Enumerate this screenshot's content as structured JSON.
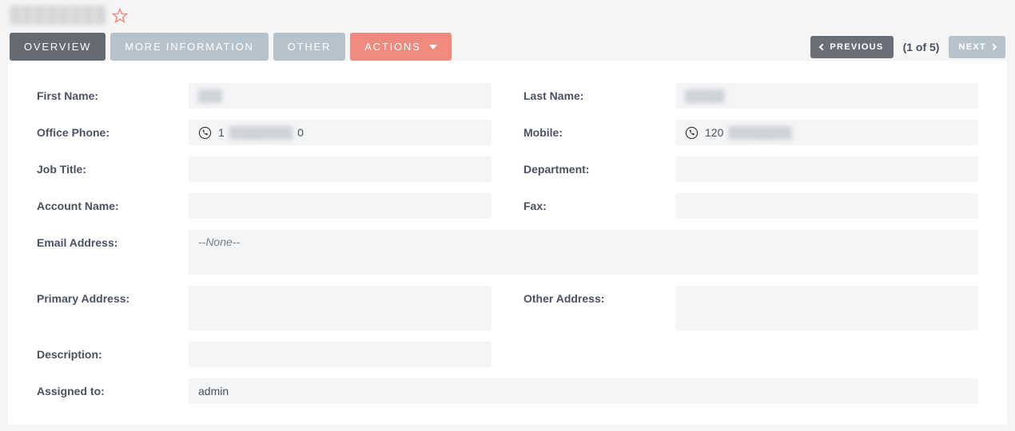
{
  "title_obscured": "████████",
  "tabs": {
    "overview": "OVERVIEW",
    "more_info": "MORE INFORMATION",
    "other": "OTHER",
    "actions": "ACTIONS"
  },
  "pager": {
    "previous": "PREVIOUS",
    "next": "NEXT",
    "position": "(1 of 5)"
  },
  "labels": {
    "first_name": "First Name:",
    "last_name": "Last Name:",
    "office_phone": "Office Phone:",
    "mobile": "Mobile:",
    "job_title": "Job Title:",
    "department": "Department:",
    "account_name": "Account Name:",
    "fax": "Fax:",
    "email": "Email Address:",
    "primary_addr": "Primary Address:",
    "other_addr": "Other Address:",
    "description": "Description:",
    "assigned_to": "Assigned to:"
  },
  "values": {
    "first_name_obscured": "███",
    "last_name_obscured": "█████",
    "office_phone_start": "1",
    "office_phone_mid_obscured": "████████",
    "office_phone_end": "0",
    "mobile_start": "120",
    "mobile_mid_obscured": "████████",
    "email_none": "--None--",
    "assigned_to": "admin"
  }
}
